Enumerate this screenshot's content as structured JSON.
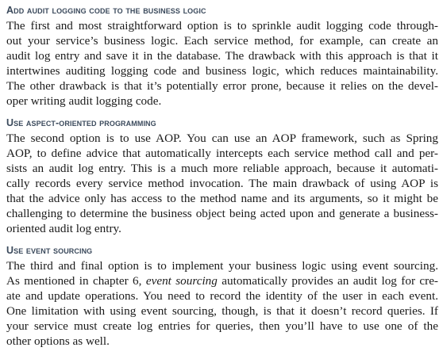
{
  "sections": [
    {
      "heading": "Add audit logging code to the business logic",
      "lines": [
        "The first and most straightforward option is to sprinkle audit logging code through-",
        "out your service’s business logic. Each service method, for example, can create an",
        "audit log entry and save it in the database. The drawback with this approach is that it",
        "intertwines auditing logging code and business logic, which reduces maintainability.",
        "The other drawback is that it’s potentially error prone, because it relies on the devel-",
        "oper writing audit logging code."
      ]
    },
    {
      "heading": "Use aspect-oriented programming",
      "lines": [
        "The second option is to use AOP. You can use an AOP framework, such as Spring",
        "AOP, to define advice that automatically intercepts each service method call and per-",
        "sists an audit log entry. This is a much more reliable approach, because it automati-",
        "cally records every service method invocation. The main drawback of using AOP is",
        "that the advice only has access to the method name and its arguments, so it might be",
        "challenging to determine the business object being acted upon and generate a business-",
        "oriented audit log entry."
      ]
    },
    {
      "heading": "Use event sourcing",
      "lines": [
        "The third and final option is to implement your business logic using event sourcing.",
        {
          "pre": "As mentioned in chapter 6, ",
          "em": "event sourcing",
          "post": " automatically provides an audit log for cre-"
        },
        "ate and update operations. You need to record the identity of the user in each event.",
        "One limitation with using event sourcing, though, is that it doesn’t record queries. If",
        "your service must create log entries for queries, then you’ll have to use one of the",
        "other options as well."
      ]
    }
  ]
}
